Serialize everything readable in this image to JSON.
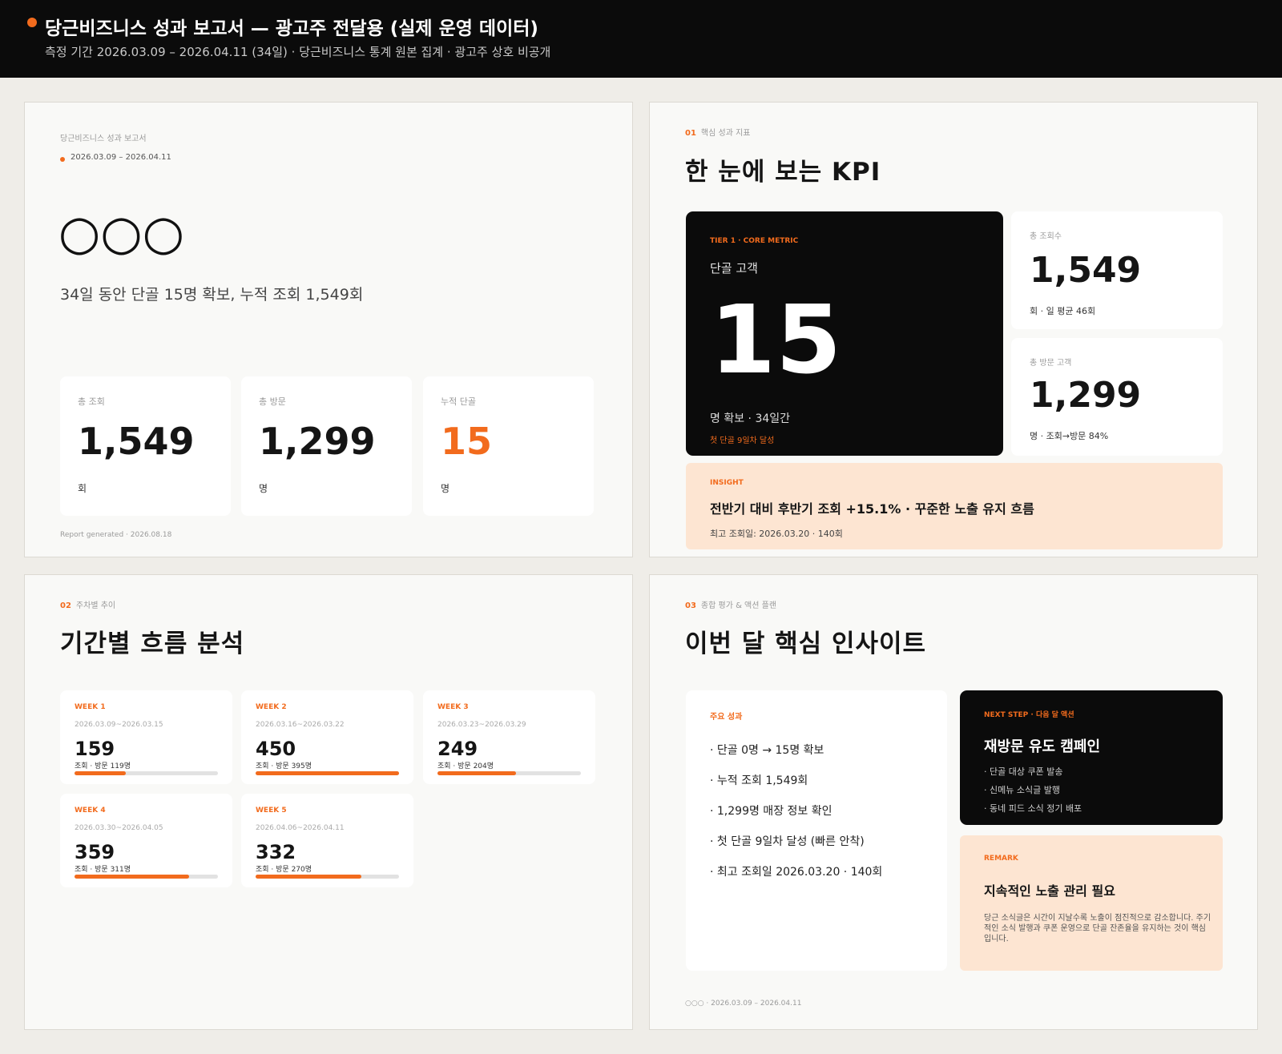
{
  "header": {
    "title": "당근비즈니스 성과 보고서 — 광고주 전달용 (실제 운영 데이터)",
    "subtitle": "측정 기간 2026.03.09 – 2026.04.11 (34일) · 당근비즈니스 통계 원본 집계 · 광고주 상호 비공개"
  },
  "cover": {
    "eyebrow": "당근비즈니스 성과 보고서",
    "period": "2026.03.09 – 2026.04.11",
    "store_name": "○○○",
    "headline": "34일 동안 단골 15명 확보, 누적 조회 1,549회",
    "kpis": [
      {
        "label": "총 조회",
        "value": "1,549",
        "unit": "회"
      },
      {
        "label": "총 방문",
        "value": "1,299",
        "unit": "명"
      },
      {
        "label": "누적 단골",
        "value": "15",
        "unit": "명"
      }
    ],
    "footer": "Report generated · 2026.08.18"
  },
  "kpi": {
    "num": "01",
    "label": "핵심 성과 지표",
    "title": "한 눈에 보는 KPI",
    "core": {
      "tier": "TIER 1 · CORE METRIC",
      "label": "단골 고객",
      "value": "15",
      "caption": "명 확보 · 34일간",
      "note": "첫 단골 9일차 달성"
    },
    "views": {
      "label": "총 조회수",
      "value": "1,549",
      "caption": "회 · 일 평균 46회"
    },
    "visits": {
      "label": "총 방문 고객",
      "value": "1,299",
      "caption": "명 · 조회→방문 84%"
    },
    "insight": {
      "tag": "INSIGHT",
      "text": "전반기 대비 후반기 조회 +15.1% · 꾸준한 노출 유지 흐름",
      "sub": "최고 조회일: 2026.03.20 · 140회"
    }
  },
  "weekly": {
    "num": "02",
    "label": "주차별 추이",
    "title": "기간별 흐름 분석",
    "weeks": [
      {
        "tag": "WEEK 1",
        "range": "2026.03.09~2026.03.15",
        "views": "159",
        "sub": "조회 · 방문 119명",
        "progress": 0.36
      },
      {
        "tag": "WEEK 2",
        "range": "2026.03.16~2026.03.22",
        "views": "450",
        "sub": "조회 · 방문 395명",
        "progress": 1.0
      },
      {
        "tag": "WEEK 3",
        "range": "2026.03.23~2026.03.29",
        "views": "249",
        "sub": "조회 · 방문 204명",
        "progress": 0.55
      },
      {
        "tag": "WEEK 4",
        "range": "2026.03.30~2026.04.05",
        "views": "359",
        "sub": "조회 · 방문 311명",
        "progress": 0.8
      },
      {
        "tag": "WEEK 5",
        "range": "2026.04.06~2026.04.11",
        "views": "332",
        "sub": "조회 · 방문 270명",
        "progress": 0.74
      }
    ]
  },
  "summary": {
    "num": "03",
    "label": "종합 평가 & 액션 플랜",
    "title": "이번 달 핵심 인사이트",
    "achievements_title": "주요 성과",
    "achievements": [
      "· 단골 0명 → 15명 확보",
      "· 누적 조회 1,549회",
      "· 1,299명 매장 정보 확인",
      "· 첫 단골 9일차 달성 (빠른 안착)",
      "· 최고 조회일 2026.03.20 · 140회"
    ],
    "next_step": {
      "tag": "NEXT STEP · 다음 달 액션",
      "title": "재방문 유도 캠페인",
      "items": [
        "· 단골 대상 쿠폰 발송",
        "· 신메뉴 소식글 발행",
        "· 동네 피드 소식 정기 배포"
      ]
    },
    "remark": {
      "tag": "REMARK",
      "title": "지속적인 노출 관리 필요",
      "body": "당근 소식글은 시간이 지날수록 노출이 점진적으로 감소합니다. 주기적인 소식 발행과 쿠폰 운영으로 단골 잔존율을 유지하는 것이 핵심입니다."
    },
    "footer": "○○○ · 2026.03.09 – 2026.04.11"
  },
  "colors": {
    "accent": "#f26b1d",
    "dark": "#0b0b0b",
    "peach": "#fde5d2",
    "page": "#efede8"
  }
}
